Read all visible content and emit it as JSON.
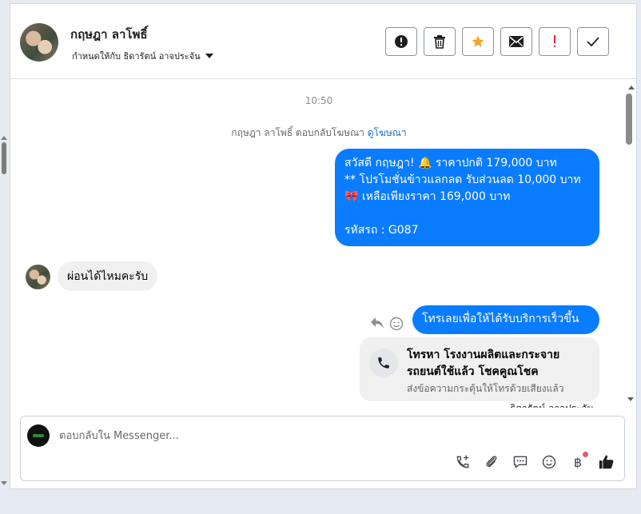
{
  "header": {
    "contact_name": "กฤษฎา ลาโพธิ์",
    "assign_label": "กำหนดให้กับ ธิดารัตน์ อาจประจัน",
    "toolbar": [
      {
        "icon": "alert-circle-icon",
        "label": "spam"
      },
      {
        "icon": "trash-icon",
        "label": "delete"
      },
      {
        "icon": "star-icon",
        "label": "star"
      },
      {
        "icon": "envelope-icon",
        "label": "mark-unread"
      },
      {
        "icon": "exclamation-icon",
        "label": "follow-up"
      },
      {
        "icon": "check-icon",
        "label": "done"
      }
    ],
    "star_color": "#f5a623",
    "exclamation_color": "#e4243b"
  },
  "chat": {
    "timestamp": "10:50",
    "notice_text": "กฤษฎา ลาโพธิ์ ตอบกลับโฆษณา",
    "notice_link": "ดูโฆษณา",
    "outgoing_1": {
      "line1": "สวัสดี กฤษฎา! 🔔 ราคาปกติ 179,000 บาท",
      "line2": "** โปรโมชั่นข้าวแลกลด รับส่วนลด 10,000 บาท",
      "line3": "🎀  เหลือเพียงราคา 169,000 บาท",
      "line4": "",
      "line5": " รหัสรถ : G087"
    },
    "incoming_1": "ผ่อนได้ไหมคะรับ",
    "outgoing_2": "โทรเลยเพื่อให้ได้รับบริการเร็วขึ้น",
    "call_card": {
      "title": "โทรหา โรงงานผลิตและกระจายรถยนต์ใช้แล้ว โชคคูณโชค",
      "subtitle": "ส่งข้อความกระตุ้นให้โทรด้วยเสียงแล้ว"
    },
    "sender_label": "ธิดารัตน์ อาจประจัน",
    "bubble_color": "#0a7cff"
  },
  "composer": {
    "placeholder": "ตอบกลับใน Messenger...",
    "tools": [
      "phone-plus-icon",
      "paperclip-icon",
      "chat-bubble-icon",
      "smiley-icon",
      "baht-icon",
      "thumbs-up-icon"
    ],
    "baht_symbol": "฿"
  }
}
